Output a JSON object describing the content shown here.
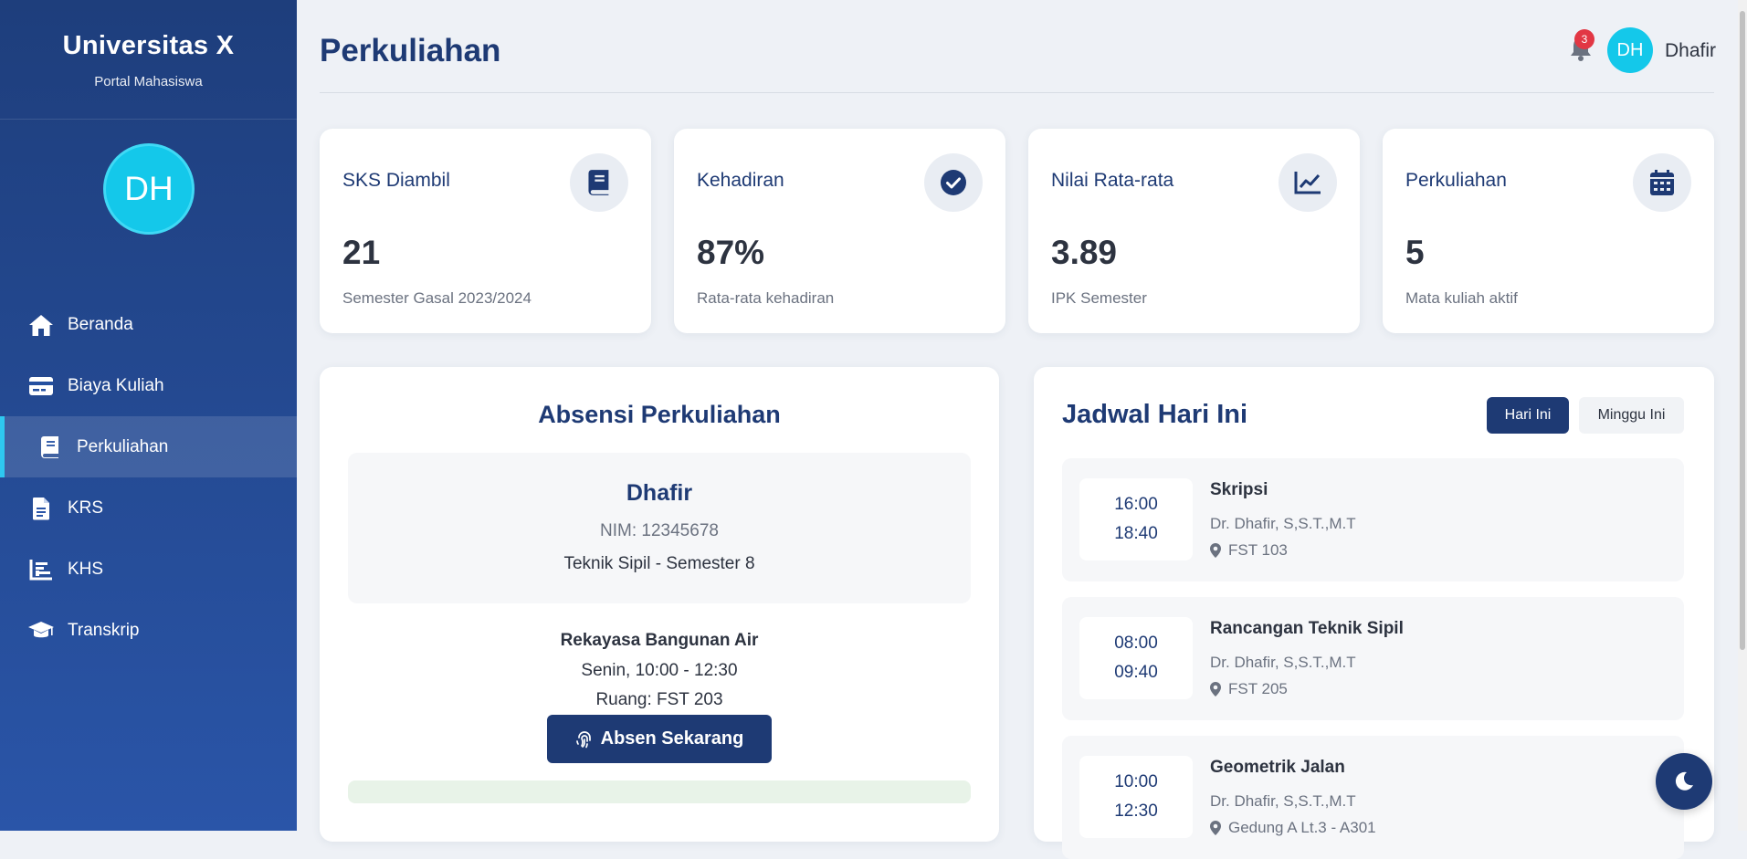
{
  "brand": {
    "title": "Universitas X",
    "subtitle": "Portal Mahasiswa"
  },
  "user": {
    "initials": "DH",
    "name": "Dhafir"
  },
  "notifications": {
    "count": "3"
  },
  "nav": [
    {
      "label": "Beranda",
      "icon": "home-icon",
      "active": false
    },
    {
      "label": "Biaya Kuliah",
      "icon": "credit-card-icon",
      "active": false
    },
    {
      "label": "Perkuliahan",
      "icon": "book-icon",
      "active": true
    },
    {
      "label": "KRS",
      "icon": "file-icon",
      "active": false
    },
    {
      "label": "KHS",
      "icon": "bar-chart-icon",
      "active": false
    },
    {
      "label": "Transkrip",
      "icon": "graduation-cap-icon",
      "active": false
    }
  ],
  "page": {
    "title": "Perkuliahan"
  },
  "stats": [
    {
      "label": "SKS Diambil",
      "value": "21",
      "sub": "Semester Gasal 2023/2024",
      "icon": "book-icon"
    },
    {
      "label": "Kehadiran",
      "value": "87%",
      "sub": "Rata-rata kehadiran",
      "icon": "check-circle-icon"
    },
    {
      "label": "Nilai Rata-rata",
      "value": "3.89",
      "sub": "IPK Semester",
      "icon": "line-chart-icon"
    },
    {
      "label": "Perkuliahan",
      "value": "5",
      "sub": "Mata kuliah aktif",
      "icon": "calendar-icon"
    }
  ],
  "absensi": {
    "title": "Absensi Perkuliahan",
    "student": {
      "name": "Dhafir",
      "nim": "NIM: 12345678",
      "program": "Teknik Sipil - Semester 8"
    },
    "course": {
      "name": "Rekayasa Bangunan Air",
      "time": "Senin, 10:00 - 12:30",
      "room": "Ruang: FST 203"
    },
    "button_label": "Absen Sekarang",
    "progress": 0
  },
  "jadwal": {
    "title": "Jadwal Hari Ini",
    "tabs": [
      {
        "label": "Hari Ini",
        "active": true
      },
      {
        "label": "Minggu Ini",
        "active": false
      }
    ],
    "items": [
      {
        "start": "16:00",
        "end": "18:40",
        "course": "Skripsi",
        "lecturer": "Dr. Dhafir, S,S.T.,M.T",
        "room": "FST 103"
      },
      {
        "start": "08:00",
        "end": "09:40",
        "course": "Rancangan Teknik Sipil",
        "lecturer": "Dr. Dhafir, S,S.T.,M.T",
        "room": "FST 205"
      },
      {
        "start": "10:00",
        "end": "12:30",
        "course": "Geometrik Jalan",
        "lecturer": "Dr. Dhafir, S,S.T.,M.T",
        "room": "Gedung A Lt.3 - A301"
      }
    ]
  },
  "colors": {
    "primary": "#1e3a74",
    "accent": "#14c8ea",
    "badge": "#e23744",
    "sidebar_top": "#1e3e7c",
    "sidebar_bottom": "#2a55a8"
  }
}
